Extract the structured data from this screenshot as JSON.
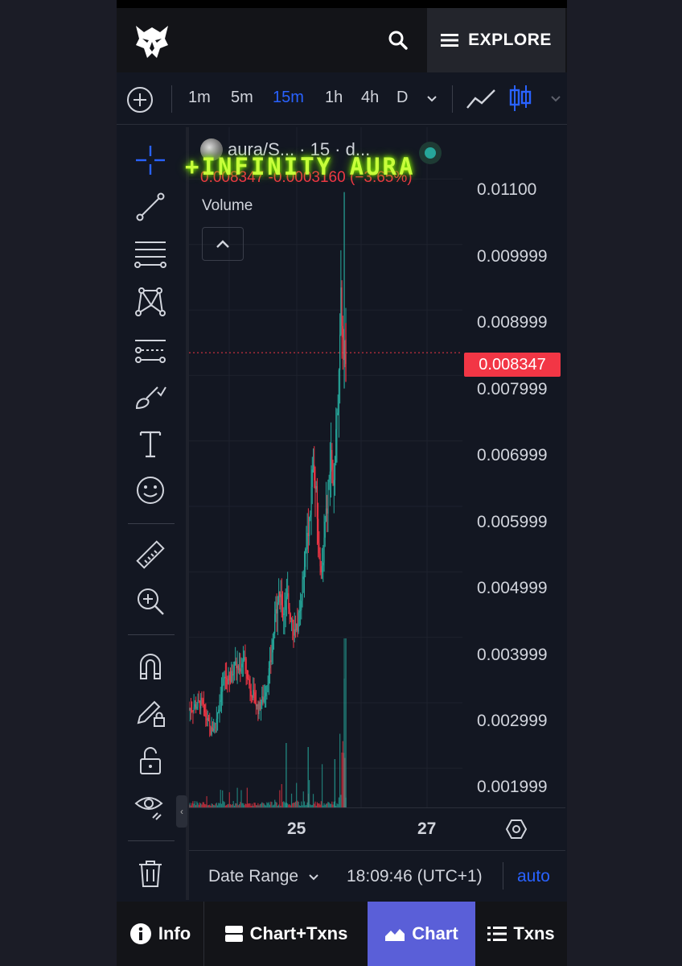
{
  "header": {
    "explore_label": "EXPLORE"
  },
  "toolbar": {
    "timeframes": [
      "1m",
      "5m",
      "15m",
      "1h",
      "4h",
      "D"
    ],
    "active_timeframe": "15m"
  },
  "legend": {
    "symbol": "aura/S...",
    "interval": "· 15 · d...",
    "last": "0.008347",
    "change": "-0.0003160",
    "change_pct": "(−3.65%)",
    "volume_label": "Volume"
  },
  "overlay_text": "+INFINITY AURA",
  "price_axis": [
    "0.01100",
    "0.009999",
    "0.008999",
    "0.007999",
    "0.006999",
    "0.005999",
    "0.004999",
    "0.003999",
    "0.002999",
    "0.001999"
  ],
  "price_tag": "0.008347",
  "time_axis": [
    "25",
    "27"
  ],
  "bottom_bar": {
    "date_range": "Date Range",
    "clock": "18:09:46 (UTC+1)",
    "auto": "auto"
  },
  "nav": {
    "info": "Info",
    "chart_txns": "Chart+Txns",
    "chart": "Chart",
    "txns": "Txns"
  },
  "colors": {
    "up": "#26a69a",
    "down": "#f23645",
    "accent": "#2962ff",
    "active_tab": "#5a5fd8"
  },
  "chart_data": {
    "type": "candlestick",
    "last_price": 0.008347,
    "ylim": [
      0.0014,
      0.0113
    ],
    "y_ticks": [
      0.011,
      0.009999,
      0.008999,
      0.007999,
      0.006999,
      0.005999,
      0.004999,
      0.003999,
      0.002999,
      0.001999
    ],
    "x_ticks": [
      "25",
      "27"
    ],
    "approx_close_path": [
      [
        0,
        0.0029
      ],
      [
        4,
        0.00295
      ],
      [
        8,
        0.003
      ],
      [
        12,
        0.0027
      ],
      [
        14,
        0.00255
      ],
      [
        17,
        0.0027
      ],
      [
        20,
        0.0031
      ],
      [
        23,
        0.0034
      ],
      [
        26,
        0.0033
      ],
      [
        29,
        0.0036
      ],
      [
        32,
        0.0035
      ],
      [
        35,
        0.0037
      ],
      [
        38,
        0.0033
      ],
      [
        41,
        0.0031
      ],
      [
        44,
        0.0029
      ],
      [
        48,
        0.0031
      ],
      [
        52,
        0.0036
      ],
      [
        55,
        0.0043
      ],
      [
        57,
        0.0047
      ],
      [
        60,
        0.0044
      ],
      [
        63,
        0.0046
      ],
      [
        66,
        0.0042
      ],
      [
        68,
        0.004
      ],
      [
        71,
        0.0045
      ],
      [
        74,
        0.0052
      ],
      [
        77,
        0.0058
      ],
      [
        79,
        0.0066
      ],
      [
        81,
        0.0062
      ],
      [
        83,
        0.0052
      ],
      [
        85,
        0.0051
      ],
      [
        87,
        0.0057
      ],
      [
        89,
        0.0063
      ],
      [
        91,
        0.0068
      ],
      [
        92,
        0.0061
      ],
      [
        93,
        0.0065
      ],
      [
        94,
        0.0072
      ],
      [
        95,
        0.0076
      ],
      [
        96,
        0.0081
      ],
      [
        97,
        0.0095
      ],
      [
        98,
        0.0085
      ],
      [
        99,
        0.0081
      ],
      [
        100,
        0.008347
      ]
    ]
  }
}
